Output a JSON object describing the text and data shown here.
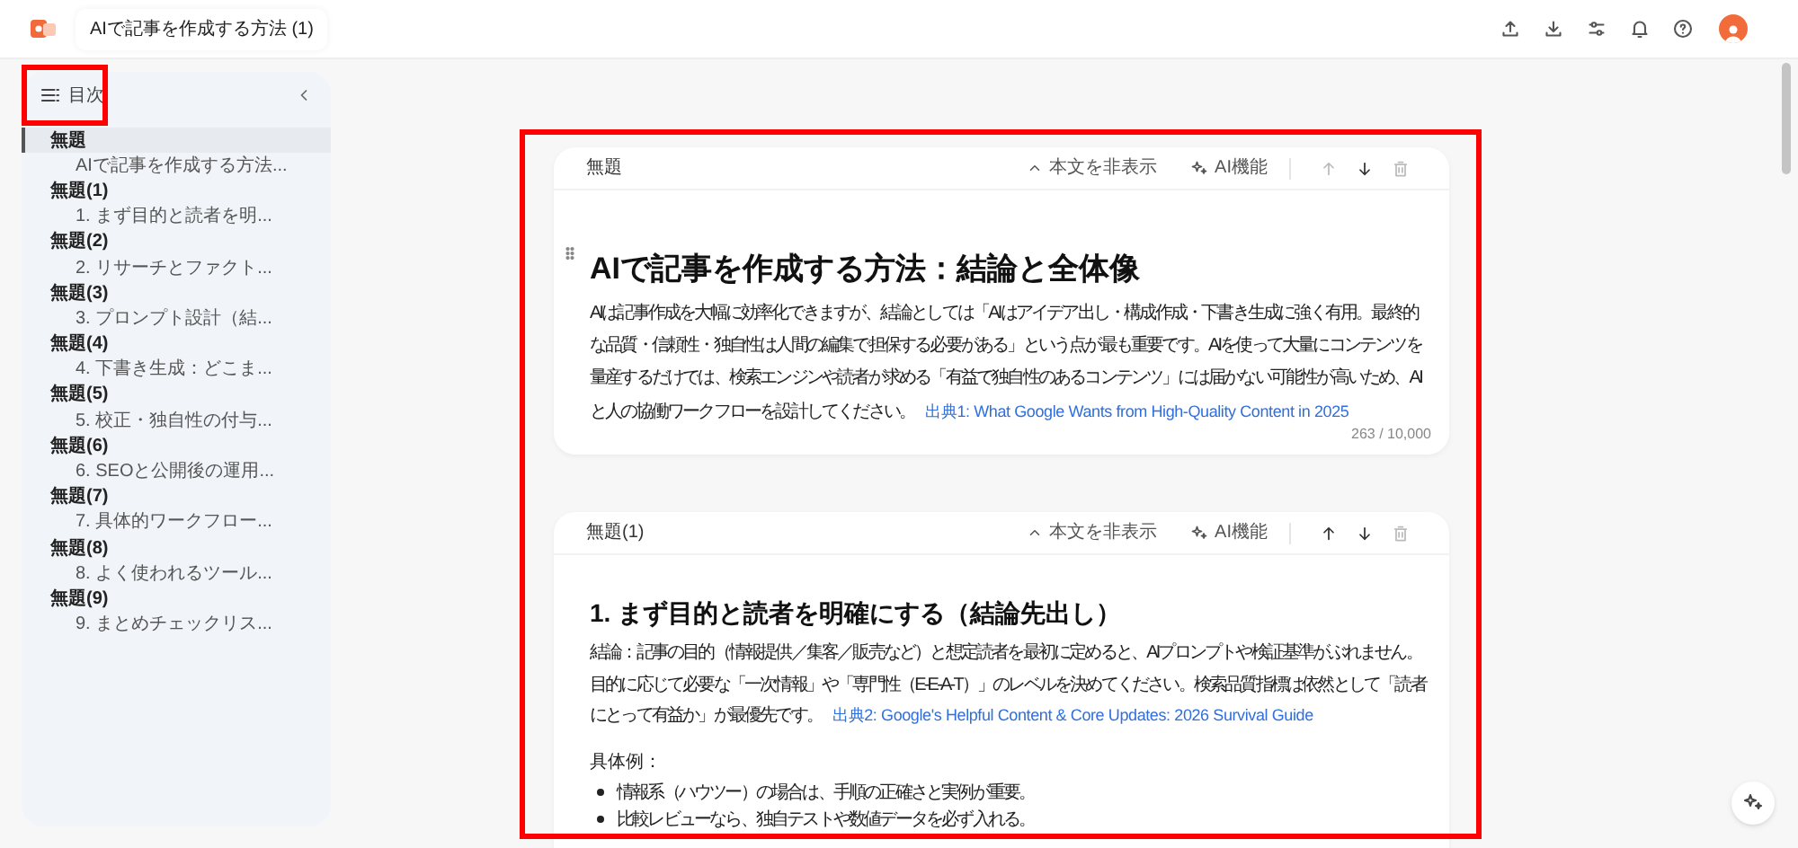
{
  "document_title": "AIで記事を作成する方法 (1)",
  "toc": {
    "title": "目次",
    "items": [
      {
        "label": "無題",
        "selected": true,
        "children": [
          {
            "label": "AIで記事を作成する方法...",
            "selected": false
          }
        ]
      },
      {
        "label": "無題(1)",
        "selected": false,
        "children": [
          {
            "label": "1. まず目的と読者を明...",
            "selected": false
          }
        ]
      },
      {
        "label": "無題(2)",
        "selected": false,
        "children": [
          {
            "label": "2. リサーチとファクト...",
            "selected": false
          }
        ]
      },
      {
        "label": "無題(3)",
        "selected": false,
        "children": [
          {
            "label": "3. プロンプト設計（結...",
            "selected": false
          }
        ]
      },
      {
        "label": "無題(4)",
        "selected": false,
        "children": [
          {
            "label": "4. 下書き生成：どこま...",
            "selected": false
          }
        ]
      },
      {
        "label": "無題(5)",
        "selected": false,
        "children": [
          {
            "label": "5. 校正・独自性の付与...",
            "selected": false
          }
        ]
      },
      {
        "label": "無題(6)",
        "selected": false,
        "children": [
          {
            "label": "6. SEOと公開後の運用...",
            "selected": false
          }
        ]
      },
      {
        "label": "無題(7)",
        "selected": false,
        "children": [
          {
            "label": "7. 具体的ワークフロー...",
            "selected": false
          }
        ]
      },
      {
        "label": "無題(8)",
        "selected": false,
        "children": [
          {
            "label": "8. よく使われるツール...",
            "selected": false
          }
        ]
      },
      {
        "label": "無題(9)",
        "selected": false,
        "children": [
          {
            "label": "9. まとめチェックリス...",
            "selected": false
          }
        ]
      }
    ]
  },
  "sections": [
    {
      "name": "無題",
      "hide_label": "本文を非表示",
      "ai_label": "AI機能",
      "move_up_disabled": true,
      "move_down_disabled": false,
      "heading": "AIで記事を作成する方法：結論と全体像",
      "kind": "title",
      "blocks": [
        {
          "kind": "paragraph",
          "text": "AIは記事作成を大幅に効率化できますが、結論としては「AIはアイデア出し・構成作成・下書き生成に強く有用。最終的な品質・信頼性・独自性は人間の編集で担保する必要がある」という点が最も重要です。AIを使って大量にコンテンツを量産するだけでは、検索エンジンや読者が求める「有益で独自性のあるコンテンツ」には届かない可能性が高いため、AIと人の協働ワークフローを設計してください。",
          "link": "出典1: What Google Wants from High-Quality Content in 2025"
        }
      ],
      "char_count": "263 / 10,000"
    },
    {
      "name": "無題(1)",
      "hide_label": "本文を非表示",
      "ai_label": "AI機能",
      "move_up_disabled": false,
      "move_down_disabled": false,
      "heading": "1. まず目的と読者を明確にする（結論先出し）",
      "kind": "section",
      "blocks": [
        {
          "kind": "paragraph",
          "text": "結論：記事の目的（情報提供／集客／販売など）と想定読者を最初に定めると、AIプロンプトや検証基準がぶれません。目的に応じて必要な「一次情報」や「専門性（E-E-A-T）」のレベルを決めてください。検索品質指標は依然として「読者にとって有益か」が最優先です。",
          "link": "出典2: Google's Helpful Content & Core Updates: 2026 Survival Guide"
        },
        {
          "kind": "label",
          "text": "具体例："
        },
        {
          "kind": "bullets",
          "items": [
            "情報系（ハウツー）の場合は、手順の正確さと実例が重要。",
            "比較レビューなら、独自テストや数値データを必ず入れる。"
          ]
        }
      ]
    }
  ]
}
